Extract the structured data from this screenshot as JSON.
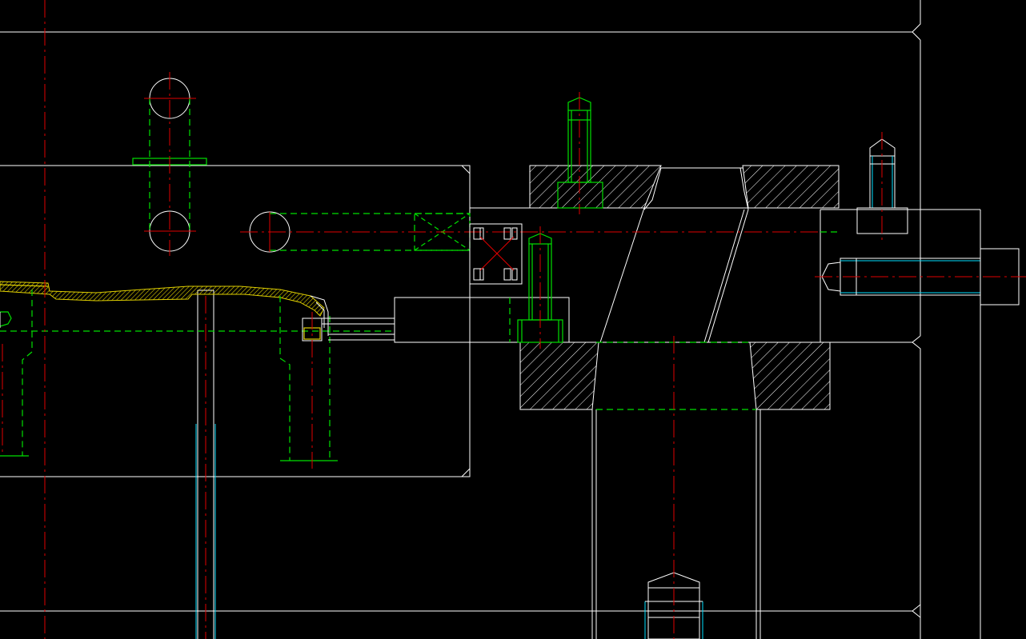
{
  "viewport": {
    "background": "#000000",
    "layer_colors": {
      "outline": "#ffffff",
      "hidden": "#00e000",
      "centerline": "#e00000",
      "pins": "#00e0ff",
      "part": "#e0d000"
    }
  }
}
